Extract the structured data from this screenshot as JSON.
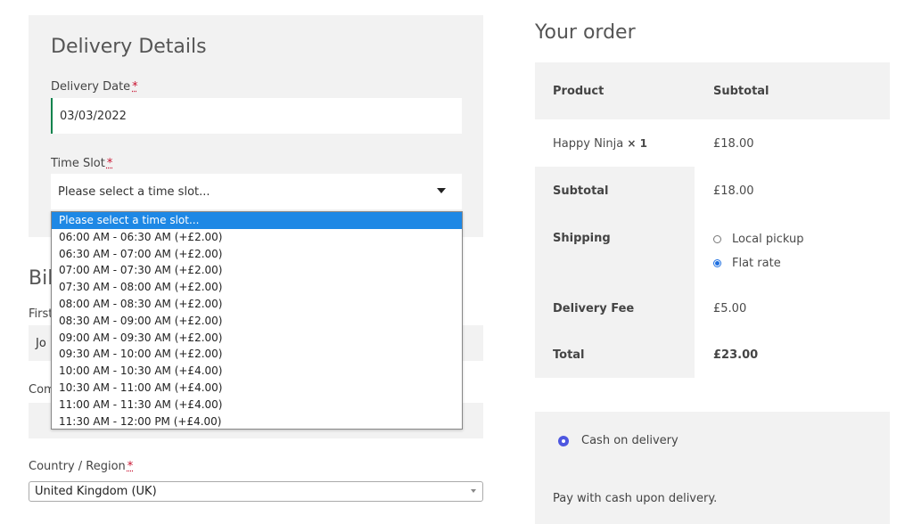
{
  "delivery": {
    "title": "Delivery Details",
    "date_label": "Delivery Date",
    "required_mark": "*",
    "date_value": "03/03/2022",
    "timeslot_label": "Time Slot",
    "timeslot_selected": "Please select a time slot...",
    "timeslot_options": [
      "Please select a time slot...",
      "06:00 AM - 06:30 AM (+£2.00)",
      "06:30 AM - 07:00 AM (+£2.00)",
      "07:00 AM - 07:30 AM (+£2.00)",
      "07:30 AM - 08:00 AM (+£2.00)",
      "08:00 AM - 08:30 AM (+£2.00)",
      "08:30 AM - 09:00 AM (+£2.00)",
      "09:00 AM - 09:30 AM (+£2.00)",
      "09:30 AM - 10:00 AM (+£2.00)",
      "10:00 AM - 10:30 AM (+£4.00)",
      "10:30 AM - 11:00 AM (+£4.00)",
      "11:00 AM - 11:30 AM (+£4.00)",
      "11:30 AM - 12:00 PM (+£4.00)"
    ]
  },
  "billing": {
    "title_partial": "Bil",
    "firstname_label_partial": "First",
    "firstname_value_partial": "Jo",
    "company_label_partial": "Com",
    "country_label": "Country / Region",
    "country_value": "United Kingdom (UK)"
  },
  "order": {
    "title": "Your order",
    "header_product": "Product",
    "header_subtotal": "Subtotal",
    "item_name": "Happy Ninja",
    "item_qty": "× 1",
    "item_price": "£18.00",
    "subtotal_label": "Subtotal",
    "subtotal_value": "£18.00",
    "shipping_label": "Shipping",
    "shipping_options": [
      "Local pickup",
      "Flat rate"
    ],
    "delivery_fee_label": "Delivery Fee",
    "delivery_fee_value": "£5.00",
    "total_label": "Total",
    "total_value": "£23.00"
  },
  "payment": {
    "method_label": "Cash on delivery",
    "description": "Pay with cash upon delivery."
  }
}
